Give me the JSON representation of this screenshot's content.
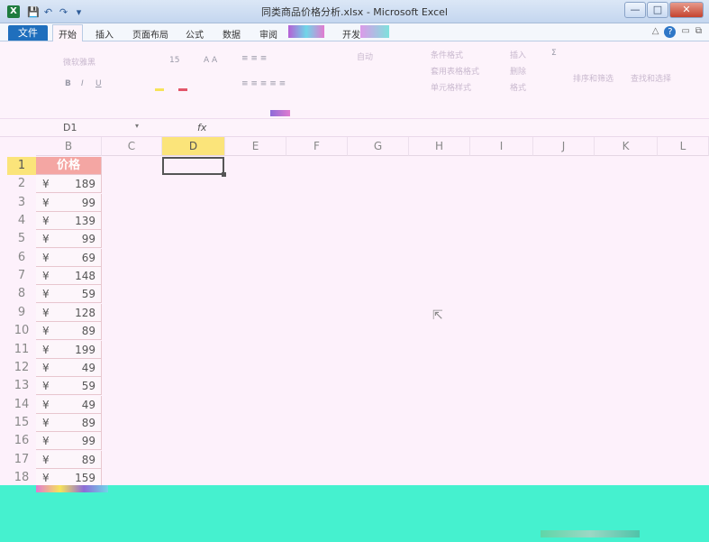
{
  "window": {
    "title": "同类商品价格分析.xlsx - Microsoft Excel",
    "app_icon": "X",
    "minimize": "—",
    "maximize": "□",
    "close": "✕"
  },
  "qat": {
    "save": "💾",
    "undo": "↶",
    "redo": "↷",
    "customize": "▾"
  },
  "tabs": {
    "file": "文件",
    "items": [
      "开始",
      "插入",
      "页面布局",
      "公式",
      "数据",
      "审阅",
      "开发"
    ],
    "active": "开始"
  },
  "tab_right": {
    "collapse": "△",
    "help": "?",
    "minimize_ribbon": "▭",
    "restore": "⧉"
  },
  "ribbon": {
    "font_name": "微软雅黑",
    "font_size": "15",
    "bold": "B",
    "italic": "I",
    "underline": "U",
    "wrap": "自动",
    "conditional_format": "条件格式",
    "insert": "插入",
    "sum": "Σ",
    "sort": "排序和筛选",
    "find": "查找和选择",
    "table_format": "套用表格格式",
    "cell_style": "单元格样式",
    "delete": "删除",
    "format": "格式"
  },
  "formula_bar": {
    "name_box": "D1",
    "fx": "fx",
    "value": ""
  },
  "columns": [
    "B",
    "C",
    "D",
    "E",
    "F",
    "G",
    "H",
    "I",
    "J",
    "K",
    "L"
  ],
  "active_column": "D",
  "active_row": 1,
  "rows": [
    1,
    2,
    3,
    4,
    5,
    6,
    7,
    8,
    9,
    10,
    11,
    12,
    13,
    14,
    15,
    16,
    17,
    18
  ],
  "sheet": {
    "header": "价格",
    "currency": "¥",
    "values": [
      189,
      99,
      139,
      99,
      69,
      148,
      59,
      128,
      89,
      199,
      49,
      59,
      49,
      89,
      99,
      89,
      159
    ]
  },
  "colors": {
    "header_fill": "#f4a6a3",
    "active_header": "#fbe47a",
    "file_tab": "#1f6fbd",
    "bottom_overlay": "#45f1cf"
  }
}
